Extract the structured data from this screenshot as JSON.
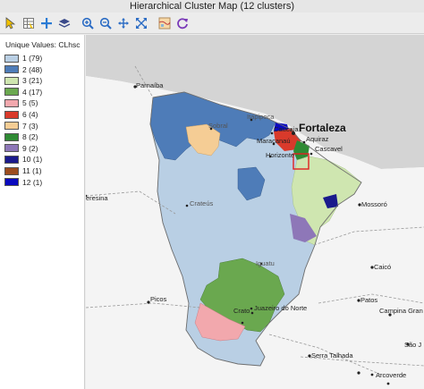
{
  "window": {
    "title": "Hierarchical Cluster Map (12 clusters)"
  },
  "toolbar": {
    "icons": [
      "select-pointer-icon",
      "selection-table-icon",
      "add-icon",
      "layers-icon",
      "zoom-in-icon",
      "zoom-out-icon",
      "pan-icon",
      "fit-extent-icon",
      "basemap-icon",
      "refresh-icon"
    ]
  },
  "legend": {
    "title": "Unique Values: CLhsc",
    "items": [
      {
        "label": "1 (79)",
        "color": "#b9cfe4"
      },
      {
        "label": "2 (48)",
        "color": "#4e7cb8"
      },
      {
        "label": "3 (21)",
        "color": "#cfe6b0"
      },
      {
        "label": "4 (17)",
        "color": "#6aa84f"
      },
      {
        "label": "5 (5)",
        "color": "#f2a8ad"
      },
      {
        "label": "6 (4)",
        "color": "#d93a2b"
      },
      {
        "label": "7 (3)",
        "color": "#f5cd95"
      },
      {
        "label": "8 (2)",
        "color": "#2f8a34"
      },
      {
        "label": "9 (2)",
        "color": "#8e77b8"
      },
      {
        "label": "10 (1)",
        "color": "#1a1a8c"
      },
      {
        "label": "11 (1)",
        "color": "#9c4d1e"
      },
      {
        "label": "12 (1)",
        "color": "#0a0abf"
      }
    ]
  },
  "map": {
    "places": {
      "parnaiba": "Parnaíba",
      "fortaleza": "Fortaleza",
      "itapipoca": "Itapipoca",
      "sobral": "Sobral",
      "caucaia": "Caucaia",
      "maracanau": "Maracanaú",
      "aquiraz": "Aquiraz",
      "horizonte": "Horizonte",
      "cascavel": "Cascavel",
      "teresina": "eresina",
      "crateus": "Crateús",
      "mossoro": "Mossoró",
      "iguatu": "Iguatu",
      "caico": "Caicó",
      "patos": "Patos",
      "picos": "Picos",
      "crato": "Crato",
      "juazeiro": "Juazeiro do Norte",
      "campina": "Campina Gran",
      "serra_talhada": "Serra Talhada",
      "sao_jose": "São J",
      "arcoverde": "Arcoverde"
    }
  }
}
